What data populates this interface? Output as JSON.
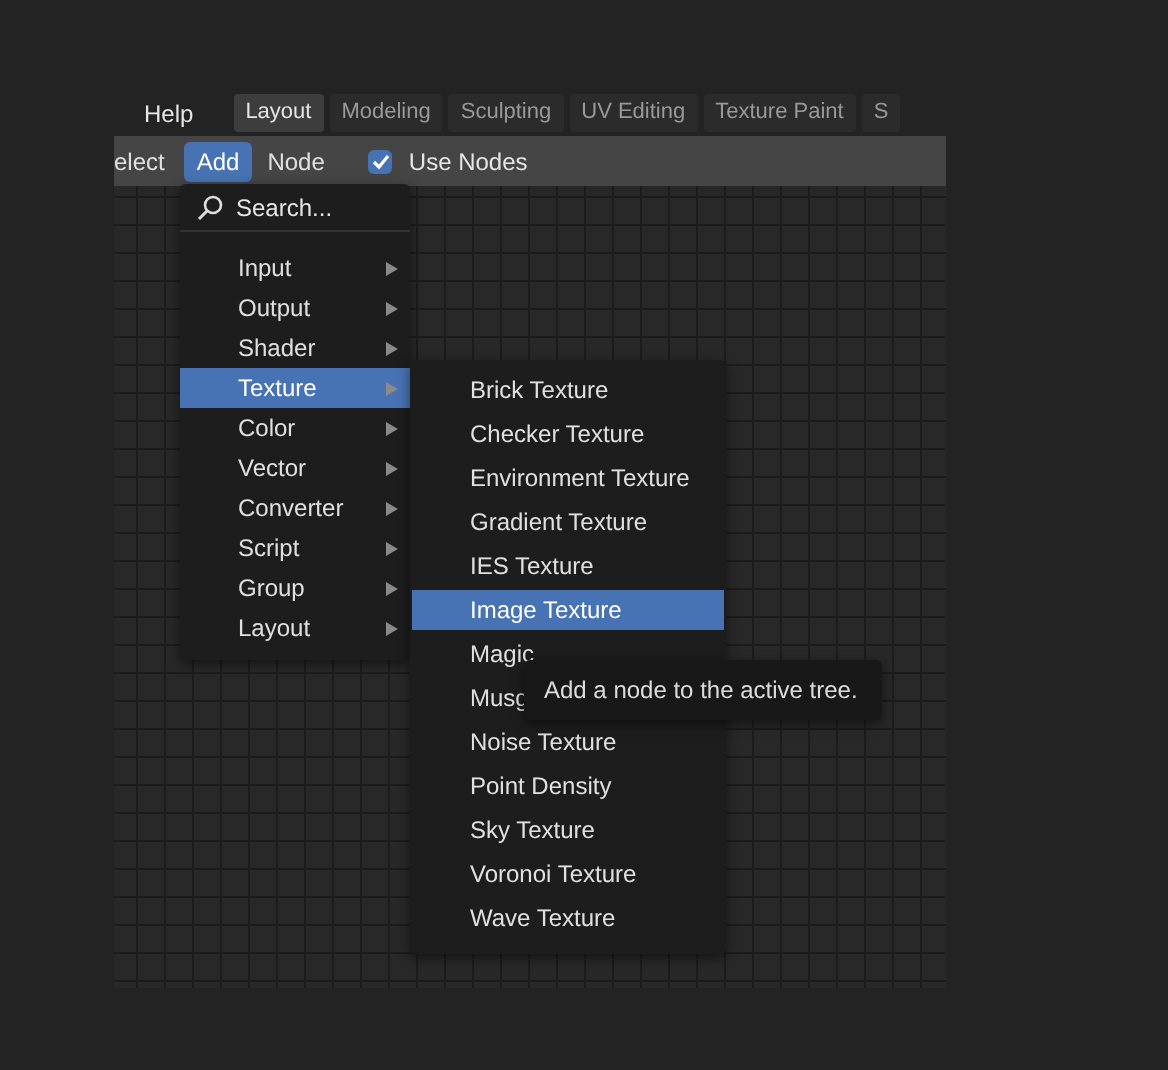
{
  "top_bar": {
    "menus": [
      {
        "label": "Help"
      }
    ],
    "workspace_tabs": [
      {
        "label": "Layout",
        "selected": true
      },
      {
        "label": "Modeling",
        "selected": false
      },
      {
        "label": "Sculpting",
        "selected": false
      },
      {
        "label": "UV Editing",
        "selected": false
      },
      {
        "label": "Texture Paint",
        "selected": false
      },
      {
        "label": "S",
        "selected": false
      }
    ]
  },
  "header": {
    "menus": [
      {
        "label": "elect",
        "selected": false
      },
      {
        "label": "Add",
        "selected": true
      },
      {
        "label": "Node",
        "selected": false
      }
    ],
    "use_nodes": {
      "label": "Use Nodes",
      "checked": true
    }
  },
  "add_menu": {
    "search": {
      "label": "Search..."
    },
    "items": [
      {
        "label": "Input",
        "selected": false
      },
      {
        "label": "Output",
        "selected": false
      },
      {
        "label": "Shader",
        "selected": false
      },
      {
        "label": "Texture",
        "selected": true
      },
      {
        "label": "Color",
        "selected": false
      },
      {
        "label": "Vector",
        "selected": false
      },
      {
        "label": "Converter",
        "selected": false
      },
      {
        "label": "Script",
        "selected": false
      },
      {
        "label": "Group",
        "selected": false
      },
      {
        "label": "Layout",
        "selected": false
      }
    ]
  },
  "texture_submenu": {
    "items": [
      {
        "label": "Brick Texture",
        "selected": false
      },
      {
        "label": "Checker Texture",
        "selected": false
      },
      {
        "label": "Environment Texture",
        "selected": false
      },
      {
        "label": "Gradient Texture",
        "selected": false
      },
      {
        "label": "IES Texture",
        "selected": false
      },
      {
        "label": "Image Texture",
        "selected": true
      },
      {
        "label": "Magic",
        "selected": false
      },
      {
        "label": "Musg",
        "selected": false
      },
      {
        "label": "Noise Texture",
        "selected": false
      },
      {
        "label": "Point Density",
        "selected": false
      },
      {
        "label": "Sky Texture",
        "selected": false
      },
      {
        "label": "Voronoi Texture",
        "selected": false
      },
      {
        "label": "Wave Texture",
        "selected": false
      }
    ]
  },
  "tooltip": {
    "text": "Add a node to the active tree."
  }
}
